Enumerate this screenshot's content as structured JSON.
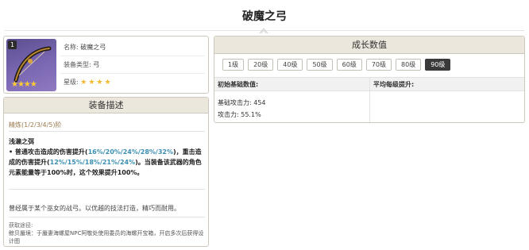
{
  "page": {
    "title": "破魔之弓"
  },
  "weapon_info": {
    "rank_badge": "1",
    "rows": [
      {
        "key": "名称:",
        "value": "破魔之弓"
      },
      {
        "key": "装备类型:",
        "value": "弓"
      },
      {
        "key": "星级:",
        "value": ""
      }
    ],
    "rarity_stars": 4
  },
  "description": {
    "header": "装备描述",
    "refinement": "精炼(1/2/3/4/5)阶",
    "passive_name": "浅濑之弭",
    "passive_parts": [
      {
        "text": "• 普通攻击造成的伤害提升(",
        "highlight": false
      },
      {
        "text": "16%/20%/24%/28%/32%",
        "highlight": true
      },
      {
        "text": ")，重击造成的伤害提升(",
        "highlight": false
      },
      {
        "text": "12%/15%/18%/21%/24%",
        "highlight": true
      },
      {
        "text": ")。当装备该武器的角色元素能量等于100%时，这个效果提升100%。",
        "highlight": false
      }
    ],
    "lore": "曾经属于某个巫女的战弓。以优越的技法打造，精巧而耐用。",
    "source_label": "获取途径:",
    "source": "鲸贝蜃境：于蜃妻海螺屋NPC阿敬处使用委员的海螺开宝箱，开启多次后获得设计图"
  },
  "growth": {
    "header": "成长数值",
    "levels": [
      "1级",
      "20级",
      "40级",
      "50级",
      "60级",
      "70级",
      "80级",
      "90级"
    ],
    "active_level": "90级",
    "col_base": "初始基础数值:",
    "col_avg": "平均每级提升:",
    "stats": [
      {
        "label": "基础攻击力:",
        "value": "454"
      },
      {
        "label": "攻击力:",
        "value": "55.1%"
      }
    ]
  },
  "colors": {
    "highlight": "#3b8fb3",
    "star": "#f3b92b",
    "header_bg": "#ece7dc",
    "active_level_bg": "#3a3a3a"
  }
}
